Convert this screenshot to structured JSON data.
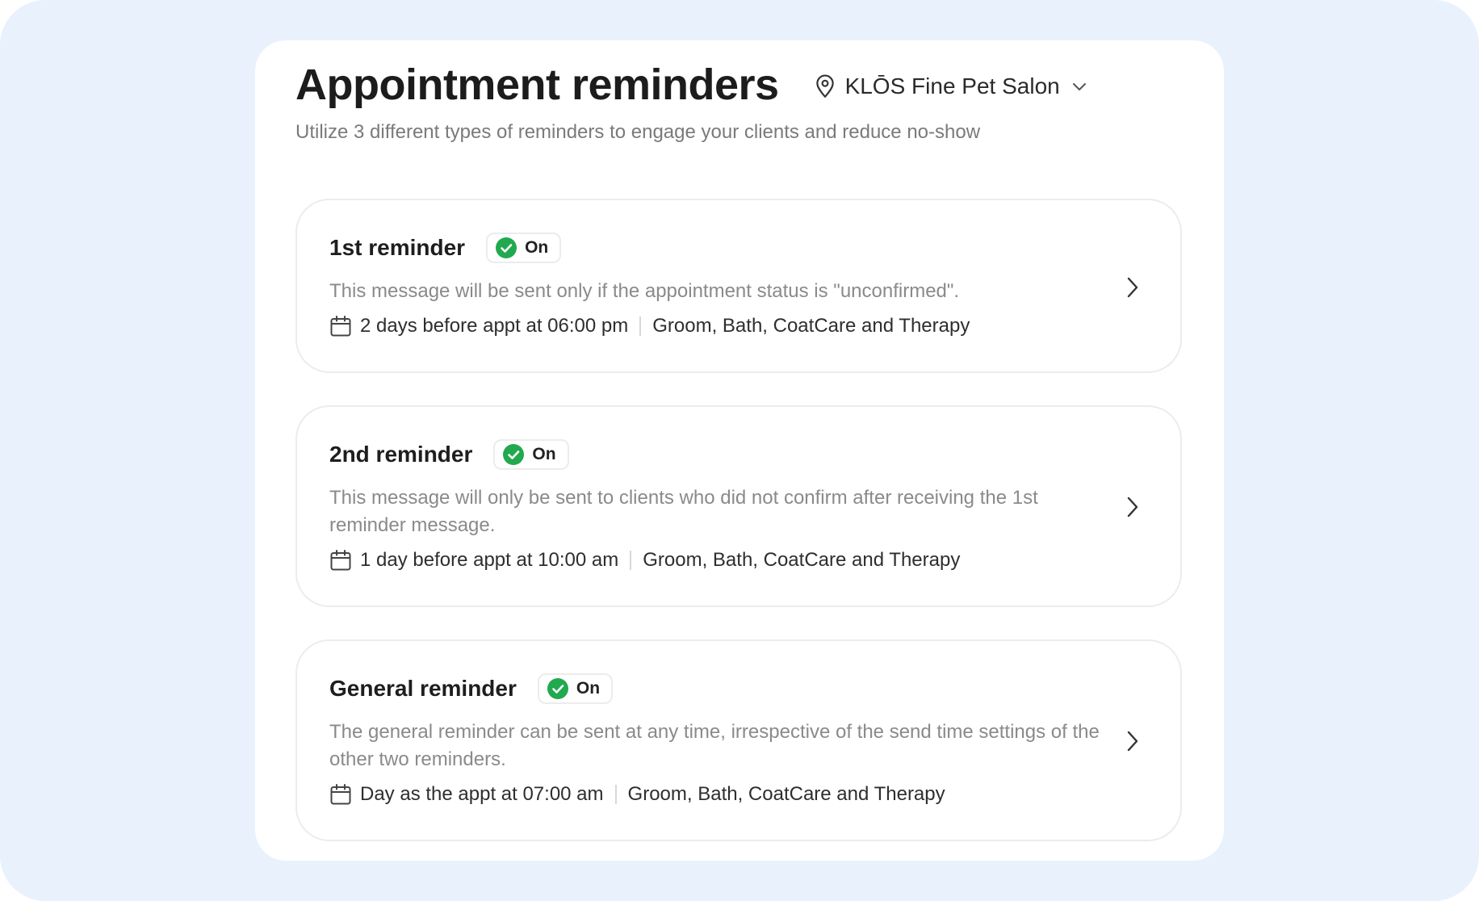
{
  "header": {
    "title": "Appointment reminders",
    "location": "KLŌS Fine Pet Salon",
    "subtitle": "Utilize 3 different types of reminders to engage your clients and reduce no-show"
  },
  "reminders": [
    {
      "title": "1st reminder",
      "status": "On",
      "description": "This message will be sent only if the appointment status is \"unconfirmed\".",
      "schedule": "2 days before appt at 06:00 pm",
      "services": "Groom, Bath, CoatCare and Therapy"
    },
    {
      "title": "2nd reminder",
      "status": "On",
      "description": "This message will only be sent to clients who did not confirm after receiving the 1st reminder message.",
      "schedule": "1 day before appt at 10:00 am",
      "services": "Groom, Bath, CoatCare and Therapy"
    },
    {
      "title": "General reminder",
      "status": "On",
      "description": "The general reminder can be sent at any time, irrespective of the send time settings of the other two reminders.",
      "schedule": "Day as the appt at 07:00 am",
      "services": "Groom, Bath, CoatCare and Therapy"
    }
  ],
  "icons": {
    "location": "map-pin-icon",
    "dropdown": "chevron-down-icon",
    "status": "check-circle-icon",
    "schedule": "calendar-icon",
    "open": "chevron-right-icon"
  },
  "colors": {
    "background": "#e9f1fd",
    "status_green": "#22a94f"
  }
}
